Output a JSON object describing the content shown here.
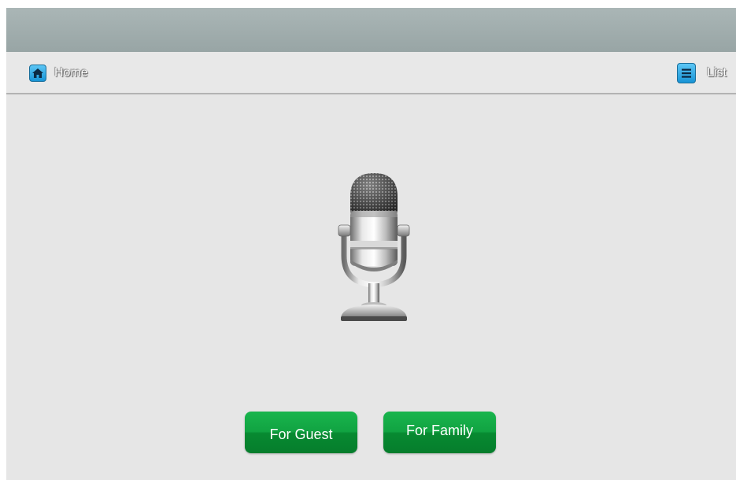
{
  "nav": {
    "home_label": "Home",
    "home_icon": "home-icon",
    "list_label": "List",
    "list_icon": "list-icon"
  },
  "main": {
    "image_icon": "microphone-icon"
  },
  "actions": {
    "guest_label": "For Guest",
    "family_label": "For Family"
  },
  "colors": {
    "status_bar": "#a3afaf",
    "background": "#e6e6e6",
    "icon_blue": "#1894d6",
    "button_green": "#0e9a3d"
  }
}
